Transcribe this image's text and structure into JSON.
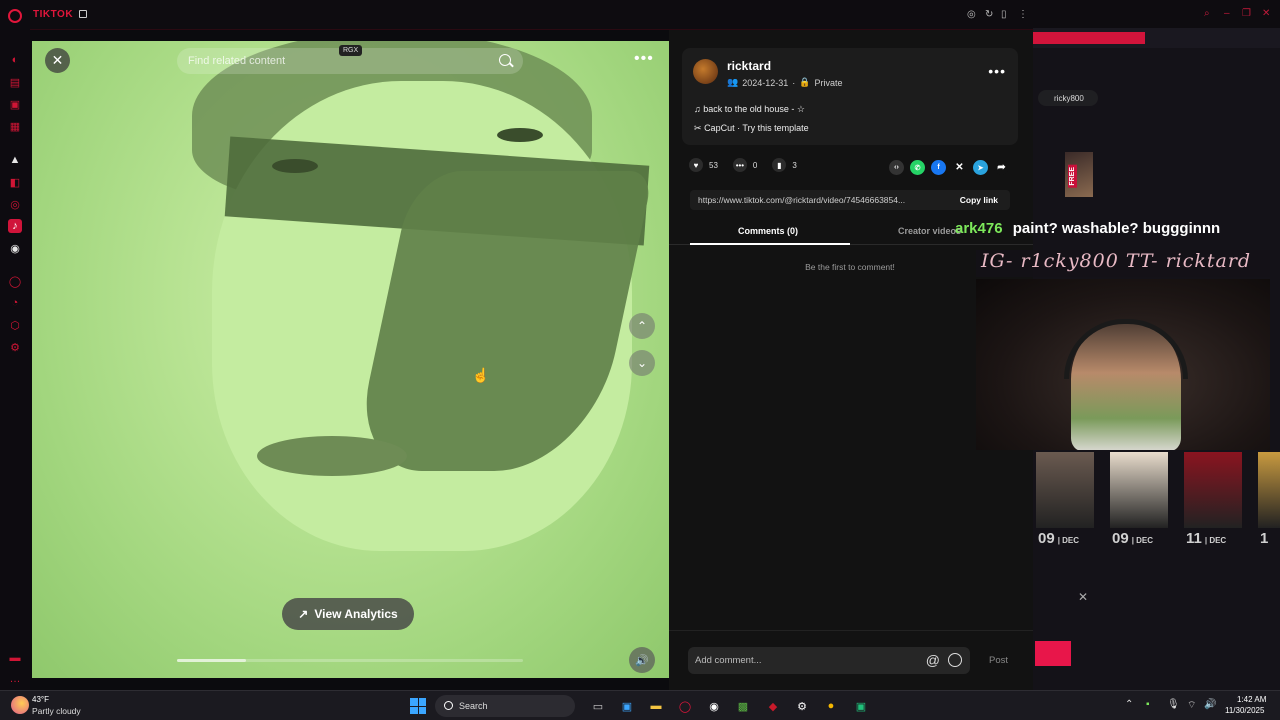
{
  "browser": {
    "site_label": "TIKTOK"
  },
  "video": {
    "search_placeholder": "Find related content",
    "badge": "RGX",
    "analytics_label": "View Analytics",
    "progress": 0.2
  },
  "author": {
    "username": "ricktard",
    "date": "2024-12-31",
    "visibility": "Private",
    "caption": "back to the old house - ☆",
    "template_text": "CapCut · Try this template"
  },
  "stats": {
    "likes": "53",
    "comments": "0",
    "saves": "3"
  },
  "link": {
    "url": "https://www.tiktok.com/@ricktard/video/74546663854...",
    "copy_label": "Copy link"
  },
  "tabs": {
    "comments": "Comments (0)",
    "creator_videos": "Creator videos"
  },
  "comments": {
    "empty_text": "Be the first to comment!",
    "input_placeholder": "Add comment...",
    "post_label": "Post"
  },
  "stream": {
    "top_user": "ricky800",
    "free_label": "FREE",
    "chat_user": "ark476",
    "chat_message": "paint? washable? buggginnn",
    "socials": "IG- r1cky800  TT- ricktard",
    "games": [
      {
        "day": "09",
        "month": "DEC",
        "color": "#6a5a50"
      },
      {
        "day": "09",
        "month": "DEC",
        "color": "#e8dccc"
      },
      {
        "day": "11",
        "month": "DEC",
        "color": "#8a1420"
      },
      {
        "day": "1",
        "month": "",
        "color": "#c89a40"
      }
    ]
  },
  "taskbar": {
    "temperature": "43°F",
    "weather": "Partly cloudy",
    "search_label": "Search",
    "time": "1:42 AM",
    "date": "11/30/2025"
  },
  "colors": {
    "accent": "#e0163b",
    "video_tint": "#b6e291",
    "chat_user": "#7de85b"
  }
}
